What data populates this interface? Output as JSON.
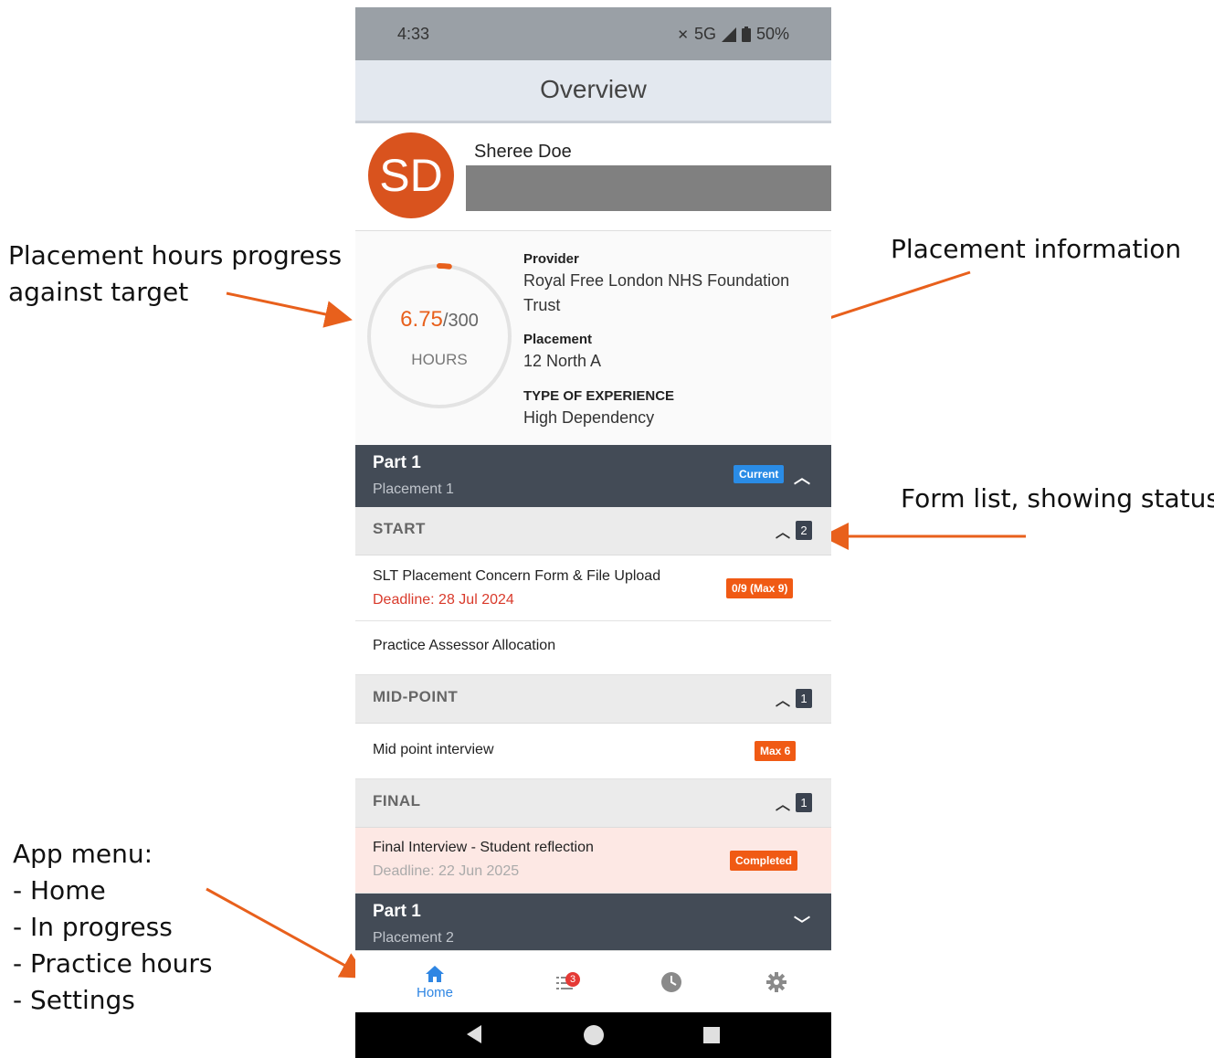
{
  "annotations": {
    "hours_progress": [
      "Placement hours progress",
      "against target"
    ],
    "placement_info": "Placement information",
    "form_list": "Form list, showing status",
    "app_menu": [
      "App menu:",
      "- Home",
      "- In progress",
      "- Practice hours",
      "- Settings"
    ]
  },
  "colors": {
    "accent": "#e8601c",
    "header": "#434b56",
    "current_badge": "#2a8ce6",
    "nav_active": "#2f86e3",
    "completed_bg": "#fde8e4"
  },
  "status_bar": {
    "time": "4:33",
    "network": "5G",
    "battery": "50%"
  },
  "app_bar": {
    "title": "Overview"
  },
  "profile": {
    "initials": "SD",
    "name": "Sheree Doe"
  },
  "hours": {
    "completed": "6.75",
    "target": "/300",
    "label": "HOURS",
    "progress_fraction": 0.0225
  },
  "placement": {
    "provider_label": "Provider",
    "provider_value": "Royal Free London NHS Foundation Trust",
    "placement_label": "Placement",
    "placement_value": "12 North A",
    "experience_label": "TYPE OF EXPERIENCE",
    "experience_value": "High Dependency"
  },
  "part1": {
    "title": "Part 1",
    "subtitle": "Placement 1",
    "badge": "Current"
  },
  "sections": {
    "start": {
      "title": "START",
      "count": "2",
      "items": [
        {
          "title": "SLT Placement Concern Form & File Upload",
          "deadline": "Deadline: 28 Jul 2024",
          "badge": "0/9 (Max 9)"
        },
        {
          "title": "Practice Assessor Allocation"
        }
      ]
    },
    "midpoint": {
      "title": "MID-POINT",
      "count": "1",
      "items": [
        {
          "title": "Mid point interview",
          "badge": "Max 6"
        }
      ]
    },
    "final": {
      "title": "FINAL",
      "count": "1",
      "items": [
        {
          "title": "Final Interview - Student reflection",
          "deadline": "Deadline: 22 Jun 2025",
          "badge": "Completed"
        }
      ]
    }
  },
  "part2": {
    "title": "Part 1",
    "subtitle": "Placement 2"
  },
  "nav": {
    "home_label": "Home",
    "in_progress_count": "3",
    "icons": [
      "home-icon",
      "list-icon",
      "clock-icon",
      "gear-icon"
    ]
  }
}
